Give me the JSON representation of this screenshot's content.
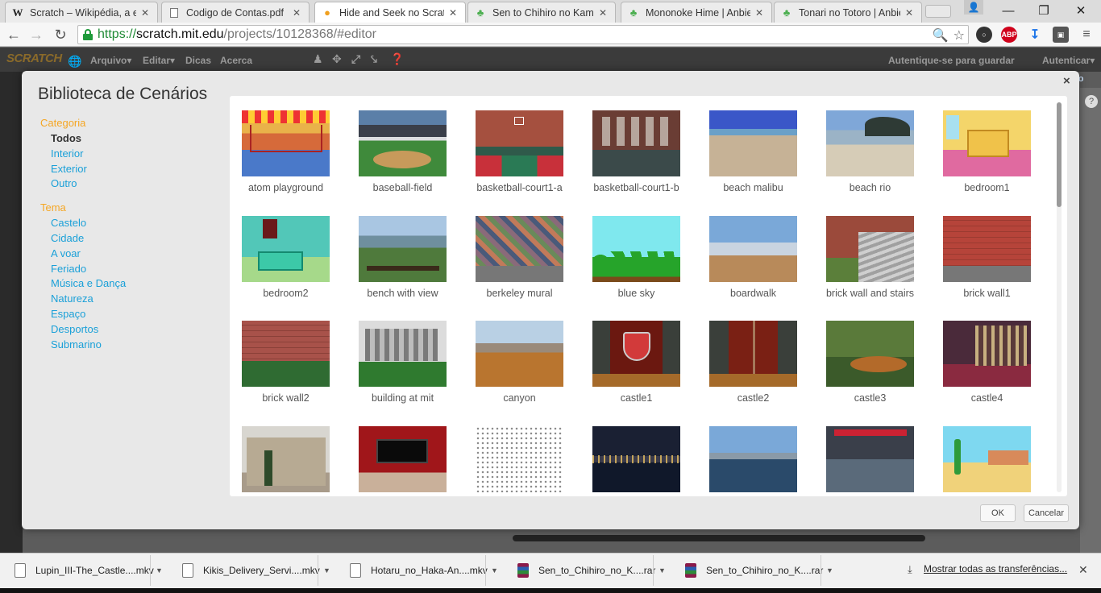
{
  "browser": {
    "tabs": [
      {
        "title": "Scratch – Wikipédia, a en",
        "icon": "W",
        "active": false
      },
      {
        "title": "Codigo de Contas.pdf",
        "icon": "doc",
        "active": false
      },
      {
        "title": "Hide and Seek no Scratch",
        "icon": "flame",
        "active": true
      },
      {
        "title": "Sen to Chihiro no Kamika",
        "icon": "clover",
        "active": false
      },
      {
        "title": "Mononoke Hime | Anbien",
        "icon": "clover",
        "active": false
      },
      {
        "title": "Tonari no Totoro | Anbien",
        "icon": "clover",
        "active": false
      }
    ],
    "url": {
      "scheme": "https://",
      "host": "scratch.mit.edu",
      "path": "/projects/10128368/#editor"
    },
    "extensions": {
      "abp": "ABP"
    }
  },
  "scratch": {
    "logo": "SCRATCH",
    "menu": [
      "Arquivo▾",
      "Editar▾",
      "Dicas",
      "Acerca"
    ],
    "signin": "Autentique-se para guardar",
    "login": "Autenticar▾"
  },
  "modal": {
    "title": "Biblioteca de Cenários",
    "close": "×",
    "category_label": "Categoria",
    "categories": [
      "Todos",
      "Interior",
      "Exterior",
      "Outro"
    ],
    "theme_label": "Tema",
    "themes": [
      "Castelo",
      "Cidade",
      "A voar",
      "Feriado",
      "Música e Dança",
      "Natureza",
      "Espaço",
      "Desportos",
      "Submarino"
    ],
    "ok": "OK",
    "cancel": "Cancelar",
    "items": [
      {
        "name": "atom playground",
        "art": "playground"
      },
      {
        "name": "baseball-field",
        "art": "baseball"
      },
      {
        "name": "basketball-court1-a",
        "art": "courtA"
      },
      {
        "name": "basketball-court1-b",
        "art": "courtB"
      },
      {
        "name": "beach malibu",
        "art": "malibu"
      },
      {
        "name": "beach rio",
        "art": "rio"
      },
      {
        "name": "bedroom1",
        "art": "bedroom1"
      },
      {
        "name": "bedroom2",
        "art": "bedroom2"
      },
      {
        "name": "bench with view",
        "art": "bench"
      },
      {
        "name": "berkeley mural",
        "art": "mural"
      },
      {
        "name": "blue sky",
        "art": "bluesky"
      },
      {
        "name": "boardwalk",
        "art": "boardwalk"
      },
      {
        "name": "brick wall and stairs",
        "art": "stairs"
      },
      {
        "name": "brick wall1",
        "art": "brick1"
      },
      {
        "name": "brick wall2",
        "art": "brick2"
      },
      {
        "name": "building at mit",
        "art": "mit"
      },
      {
        "name": "canyon",
        "art": "canyon"
      },
      {
        "name": "castle1",
        "art": "castle1"
      },
      {
        "name": "castle2",
        "art": "castle2"
      },
      {
        "name": "castle3",
        "art": "castle3"
      },
      {
        "name": "castle4",
        "art": "castle4"
      },
      {
        "name": "",
        "art": "chateau"
      },
      {
        "name": "",
        "art": "stage"
      },
      {
        "name": "",
        "art": "pattern"
      },
      {
        "name": "",
        "art": "nightcity"
      },
      {
        "name": "",
        "art": "harbor"
      },
      {
        "name": "",
        "art": "hallway"
      },
      {
        "name": "",
        "art": "desert"
      }
    ]
  },
  "downloads": {
    "items": [
      {
        "name": "Lupin_III-The_Castle....mkv",
        "type": "file"
      },
      {
        "name": "Kikis_Delivery_Servi....mkv",
        "type": "file"
      },
      {
        "name": "Hotaru_no_Haka-An....mkv",
        "type": "file"
      },
      {
        "name": "Sen_to_Chihiro_no_K....rar",
        "type": "rar"
      },
      {
        "name": "Sen_to_Chihiro_no_K....rar",
        "type": "rar"
      }
    ],
    "show_all": "Mostrar todas as  transferências..."
  }
}
